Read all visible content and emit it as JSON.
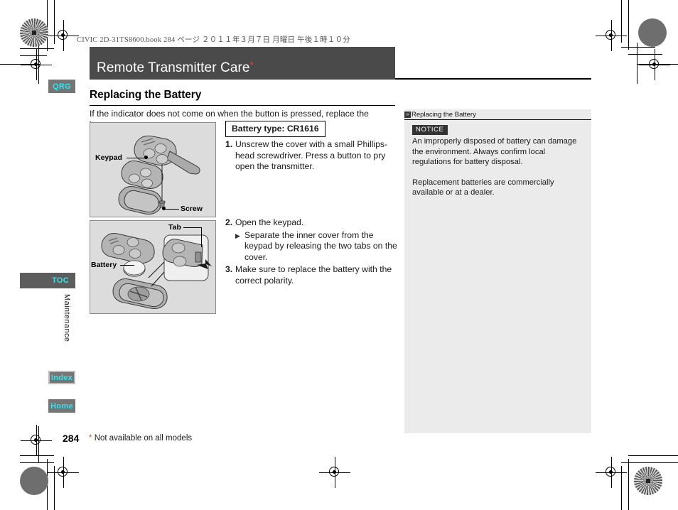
{
  "document": {
    "header_line": "CIVIC 2D-31TS8600.book   284 ページ   ２０１１年３月７日   月曜日   午後１時１０分",
    "page_number": "284",
    "footnote_marker": "*",
    "footnote_text": "Not available on all models"
  },
  "title_bar": {
    "title": "Remote Transmitter Care",
    "asterisk": "*"
  },
  "main": {
    "section_title": "Replacing the Battery",
    "intro": "If the indicator does not come on when the button is pressed, replace the battery.",
    "battery_type": "Battery type: CR1616",
    "steps": [
      {
        "num": "1.",
        "text": "Unscrew the cover with a small Phillips-head screwdriver. Press a button to pry open the transmitter."
      },
      {
        "num": "2.",
        "text": "Open the keypad.",
        "substeps": [
          "Separate the inner cover from the keypad by releasing the two tabs on the cover."
        ]
      },
      {
        "num": "3.",
        "text": "Make sure to replace the battery with the correct polarity."
      }
    ]
  },
  "figures": [
    {
      "name": "transmitter-exploded-view",
      "labels": [
        "Keypad",
        "Screw"
      ]
    },
    {
      "name": "battery-replacement-view",
      "labels": [
        "Battery",
        "Tab"
      ]
    }
  ],
  "sidebar_right": {
    "header": "Replacing the Battery",
    "notice_badge": "NOTICE",
    "paragraphs": [
      "An improperly disposed of battery can damage the environment. Always confirm local regulations for battery disposal.",
      "Replacement batteries are commercially available or at a dealer."
    ]
  },
  "nav_tabs": {
    "qrg": "QRG",
    "toc": "TOC",
    "index": "Index",
    "home": "Home",
    "section_label": "Maintenance"
  },
  "colors": {
    "title_band": "#4a4a4a",
    "tab_bg": "#757575",
    "tab_text": "#2ee6f0",
    "asterisk_red": "#e8433f",
    "sidebar_bg": "#ebebeb",
    "figure_bg": "#dcdcdc"
  }
}
